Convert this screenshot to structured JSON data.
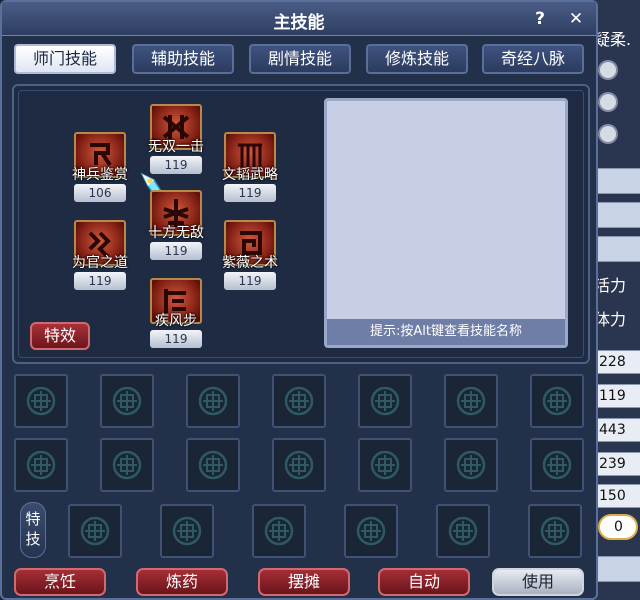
{
  "window": {
    "title": "主技能",
    "help": "?",
    "close": "✕"
  },
  "tabs": [
    {
      "label": "师门技能",
      "active": true
    },
    {
      "label": "辅助技能",
      "active": false
    },
    {
      "label": "剧情技能",
      "active": false
    },
    {
      "label": "修炼技能",
      "active": false
    },
    {
      "label": "奇经八脉",
      "active": false
    }
  ],
  "skills": [
    {
      "name": "无双一击",
      "level": "119"
    },
    {
      "name": "神兵鉴赏",
      "level": "106"
    },
    {
      "name": "文韬武略",
      "level": "119"
    },
    {
      "name": "十方无敌",
      "level": "119"
    },
    {
      "name": "为官之道",
      "level": "119"
    },
    {
      "name": "紫薇之术",
      "level": "119"
    },
    {
      "name": "疾风步",
      "level": "119"
    }
  ],
  "effect_button": "特效",
  "info_box": {
    "hint": "提示:按Alt键查看技能名称"
  },
  "special_label": "特技",
  "bottom_buttons": [
    "烹饪",
    "炼药",
    "摆摊",
    "自动",
    "使用"
  ],
  "side_panel": {
    "top_text": "疑柔.",
    "label_vitality": "活力",
    "label_stamina": "体力",
    "values": [
      "228",
      "119",
      "443",
      "239",
      "150"
    ],
    "pill_value": "0"
  }
}
